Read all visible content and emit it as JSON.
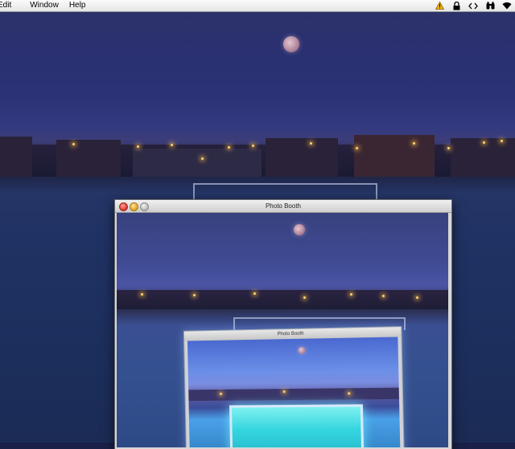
{
  "menubar": {
    "items": [
      "Edit",
      "Window",
      "Help"
    ],
    "status_icons": [
      "warning-icon",
      "lock-icon",
      "code-icon",
      "binoculars-icon",
      "wifi-icon"
    ]
  },
  "window": {
    "title": "Photo Booth"
  },
  "inner_window": {
    "title": "Photo Booth"
  },
  "colors": {
    "sky": "#2b3376",
    "field": "#1f3263",
    "lamp": "#ffd36a",
    "close": "#d8342b",
    "minimize": "#e0a21e",
    "zoom": "#b4b4b4"
  }
}
